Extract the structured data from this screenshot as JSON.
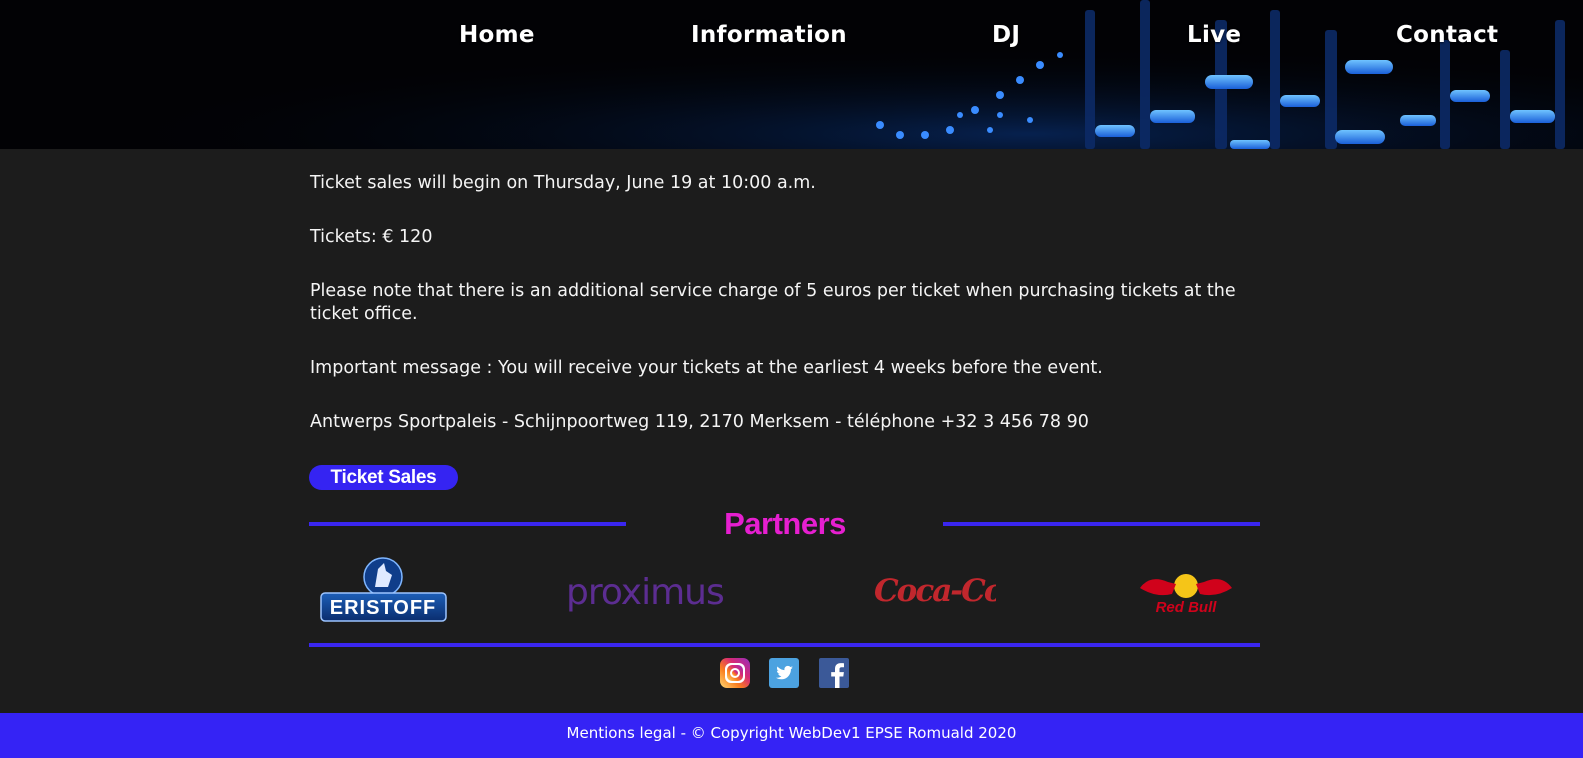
{
  "nav": {
    "items": [
      {
        "label": "Home"
      },
      {
        "label": "Information"
      },
      {
        "label": "DJ"
      },
      {
        "label": "Live"
      },
      {
        "label": "Contact"
      }
    ]
  },
  "content": {
    "paragraphs": [
      "Ticket sales will begin on Thursday, June 19 at 10:00 a.m.",
      "Tickets: € 120",
      "Please note that there is an additional service charge of 5 euros per ticket when purchasing tickets at the ticket office.",
      "Important message : You will receive your tickets at the earliest 4 weeks before the event.",
      "Antwerps Sportpaleis - Schijnpoortweg 119, 2170 Merksem - téléphone +32 3 456 78 90"
    ],
    "ticket_button": "Ticket Sales"
  },
  "partners": {
    "title": "Partners",
    "logos": [
      {
        "name": "ERISTOFF",
        "icon": "eristoff-logo"
      },
      {
        "name": "proximus",
        "icon": "proximus-logo"
      },
      {
        "name": "Coca-Cola",
        "icon": "coca-cola-logo"
      },
      {
        "name": "Red Bull",
        "icon": "red-bull-logo"
      }
    ]
  },
  "social": [
    {
      "icon": "instagram-icon"
    },
    {
      "icon": "twitter-icon"
    },
    {
      "icon": "facebook-icon"
    }
  ],
  "footer": {
    "text": "Mentions legal - © Copyright WebDev1 EPSE Romuald 2020"
  },
  "colors": {
    "accent_blue": "#3524f2",
    "partners_title": "#e61fd0",
    "background": "#1c1c1c",
    "header_bg": "#020205"
  }
}
